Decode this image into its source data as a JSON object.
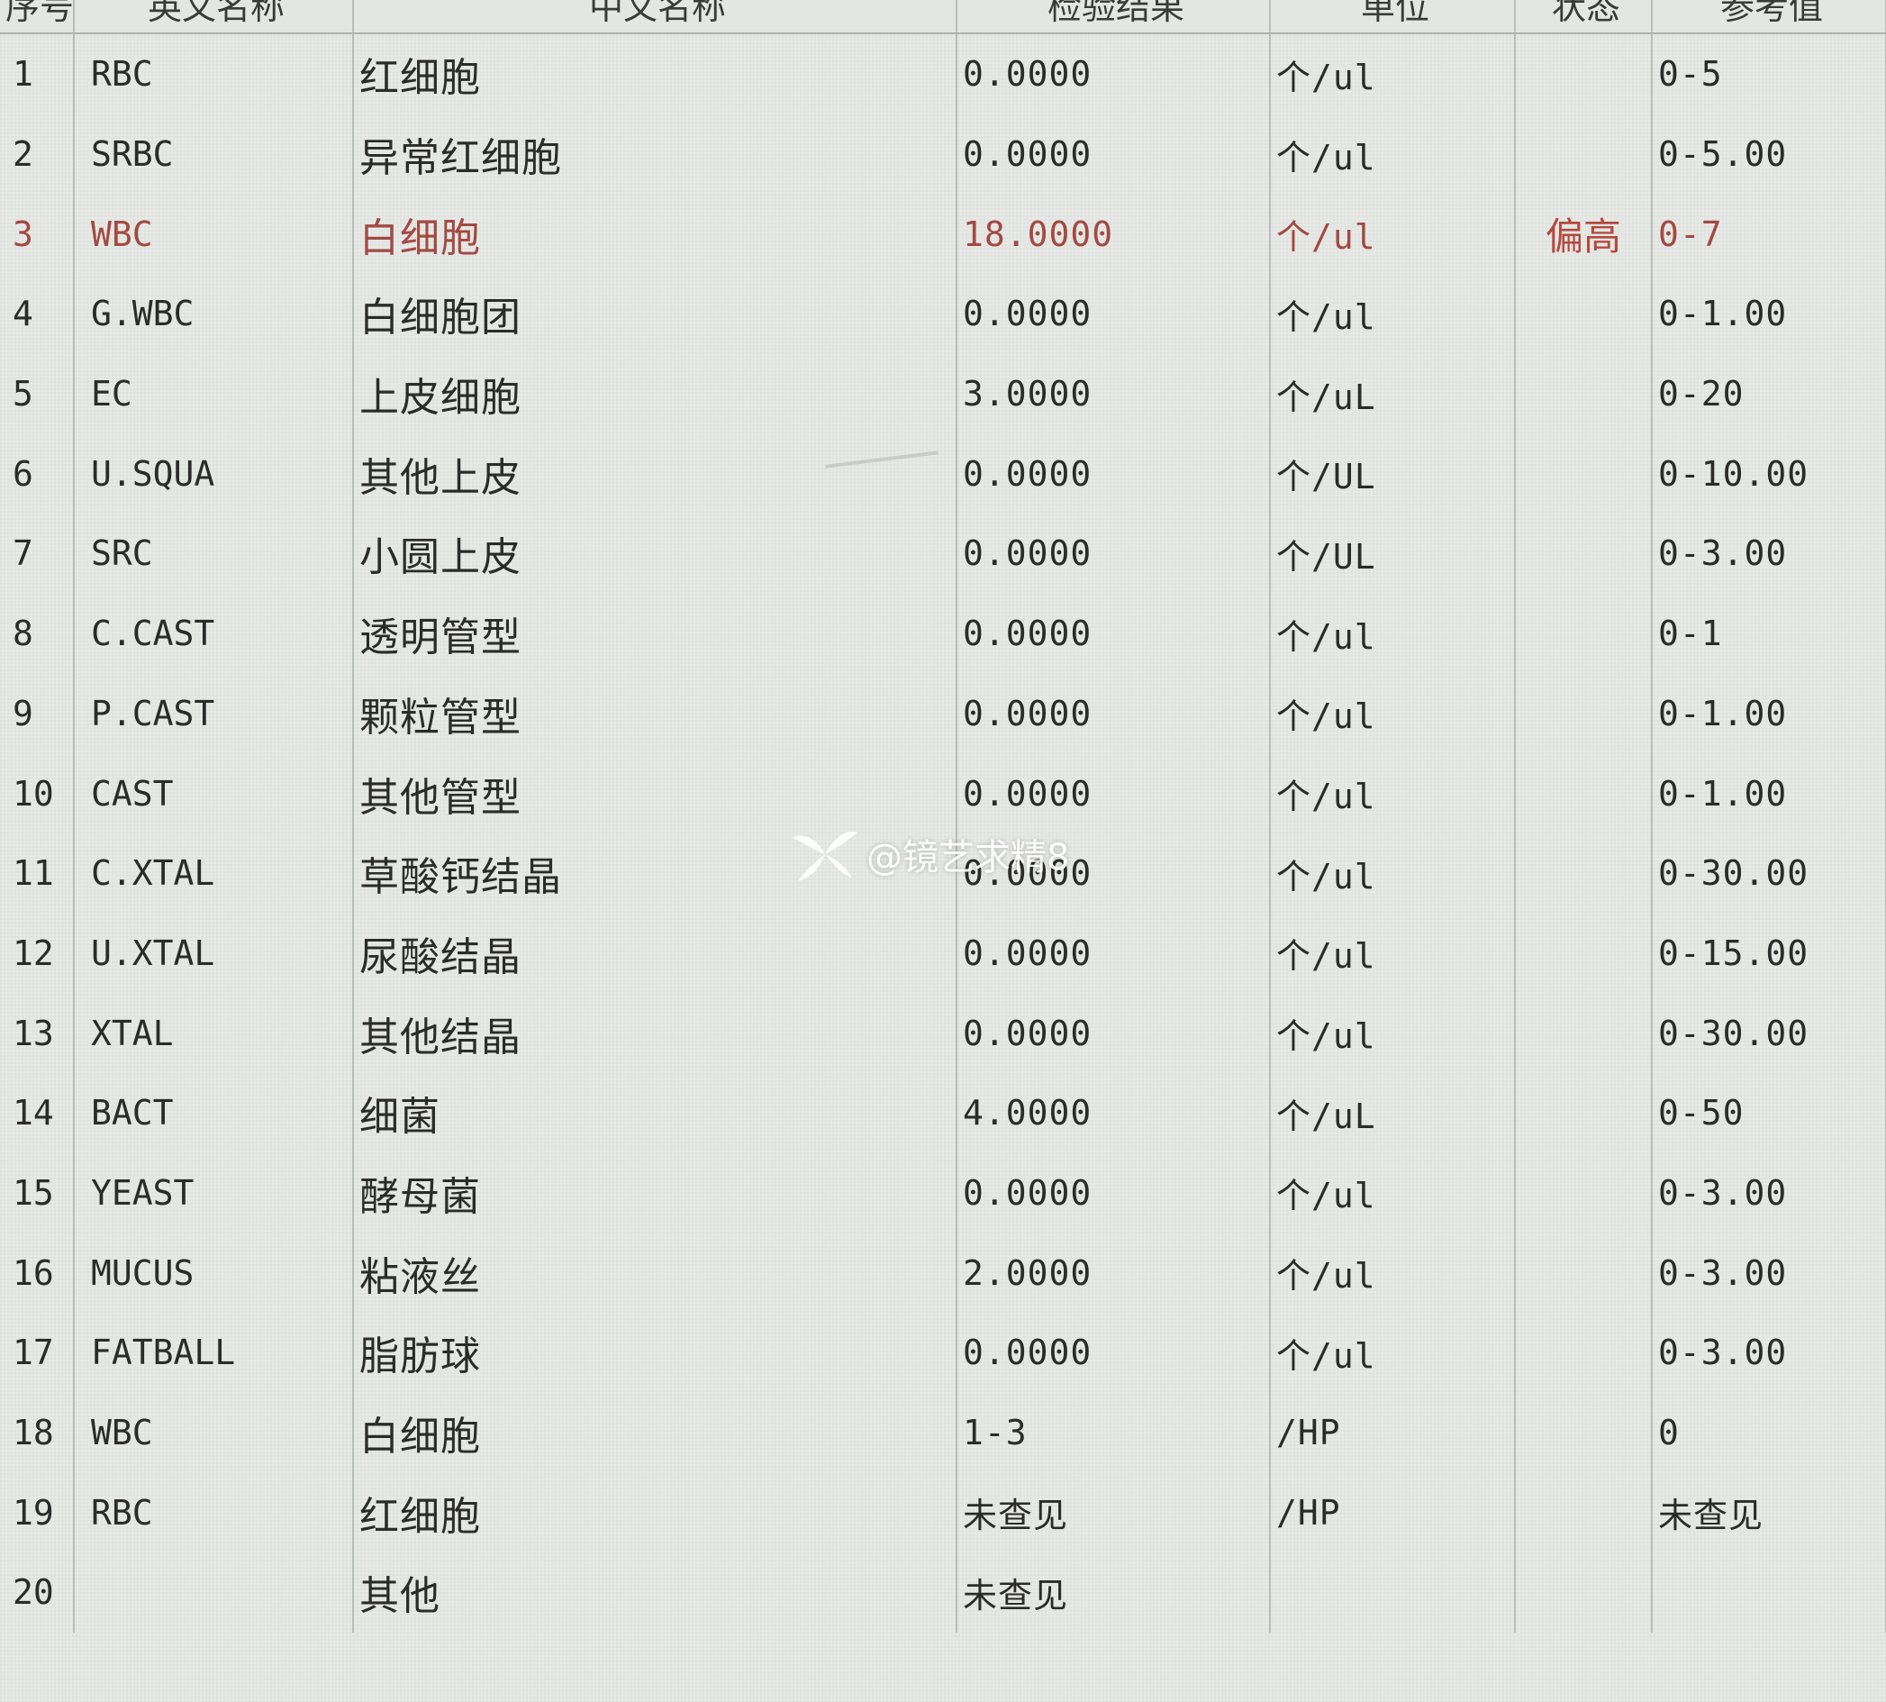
{
  "table": {
    "headers": [
      "序号",
      "英文名称",
      "中文名称",
      "检验结果",
      "单位",
      "状态",
      "参考值"
    ],
    "rows": [
      {
        "no": "1",
        "en": "RBC",
        "cn": "红细胞",
        "result": "0.0000",
        "unit": "个/ul",
        "status": "",
        "ref": "0-5"
      },
      {
        "no": "2",
        "en": "SRBC",
        "cn": "异常红细胞",
        "result": "0.0000",
        "unit": "个/ul",
        "status": "",
        "ref": "0-5.00"
      },
      {
        "no": "3",
        "en": "WBC",
        "cn": "白细胞",
        "result": "18.0000",
        "unit": "个/ul",
        "status": "偏高",
        "ref": "0-7"
      },
      {
        "no": "4",
        "en": "G.WBC",
        "cn": "白细胞团",
        "result": "0.0000",
        "unit": "个/ul",
        "status": "",
        "ref": "0-1.00"
      },
      {
        "no": "5",
        "en": "EC",
        "cn": "上皮细胞",
        "result": "3.0000",
        "unit": "个/uL",
        "status": "",
        "ref": "0-20"
      },
      {
        "no": "6",
        "en": "U.SQUA",
        "cn": "其他上皮",
        "result": "0.0000",
        "unit": "个/UL",
        "status": "",
        "ref": "0-10.00"
      },
      {
        "no": "7",
        "en": "SRC",
        "cn": "小圆上皮",
        "result": "0.0000",
        "unit": "个/UL",
        "status": "",
        "ref": "0-3.00"
      },
      {
        "no": "8",
        "en": "C.CAST",
        "cn": "透明管型",
        "result": "0.0000",
        "unit": "个/ul",
        "status": "",
        "ref": "0-1"
      },
      {
        "no": "9",
        "en": "P.CAST",
        "cn": "颗粒管型",
        "result": "0.0000",
        "unit": "个/ul",
        "status": "",
        "ref": "0-1.00"
      },
      {
        "no": "10",
        "en": "CAST",
        "cn": "其他管型",
        "result": "0.0000",
        "unit": "个/ul",
        "status": "",
        "ref": "0-1.00"
      },
      {
        "no": "11",
        "en": "C.XTAL",
        "cn": "草酸钙结晶",
        "result": "0.0000",
        "unit": "个/ul",
        "status": "",
        "ref": "0-30.00"
      },
      {
        "no": "12",
        "en": "U.XTAL",
        "cn": "尿酸结晶",
        "result": "0.0000",
        "unit": "个/ul",
        "status": "",
        "ref": "0-15.00"
      },
      {
        "no": "13",
        "en": "XTAL",
        "cn": "其他结晶",
        "result": "0.0000",
        "unit": "个/ul",
        "status": "",
        "ref": "0-30.00"
      },
      {
        "no": "14",
        "en": "BACT",
        "cn": "细菌",
        "result": "4.0000",
        "unit": "个/uL",
        "status": "",
        "ref": "0-50"
      },
      {
        "no": "15",
        "en": "YEAST",
        "cn": "酵母菌",
        "result": "0.0000",
        "unit": "个/ul",
        "status": "",
        "ref": "0-3.00"
      },
      {
        "no": "16",
        "en": "MUCUS",
        "cn": "粘液丝",
        "result": "2.0000",
        "unit": "个/ul",
        "status": "",
        "ref": "0-3.00"
      },
      {
        "no": "17",
        "en": "FATBALL",
        "cn": "脂肪球",
        "result": "0.0000",
        "unit": "个/ul",
        "status": "",
        "ref": "0-3.00"
      },
      {
        "no": "18",
        "en": "WBC",
        "cn": "白细胞",
        "result": "1-3",
        "unit": "/HP",
        "status": "",
        "ref": "0"
      },
      {
        "no": "19",
        "en": "RBC",
        "cn": "红细胞",
        "result": "未查见",
        "unit": "/HP",
        "status": "",
        "ref": "未查见"
      },
      {
        "no": "20",
        "en": "",
        "cn": "其他",
        "result": "未查见",
        "unit": "",
        "status": "",
        "ref": ""
      }
    ],
    "highlight_row": 2
  },
  "watermark": {
    "text": "@镜艺求精8",
    "icon": "leaf-logo-icon"
  },
  "colors": {
    "background": "#e8eae7",
    "grid": "#b9bdb9",
    "text": "#2b2b2b",
    "flag_high": "#a24a42"
  }
}
